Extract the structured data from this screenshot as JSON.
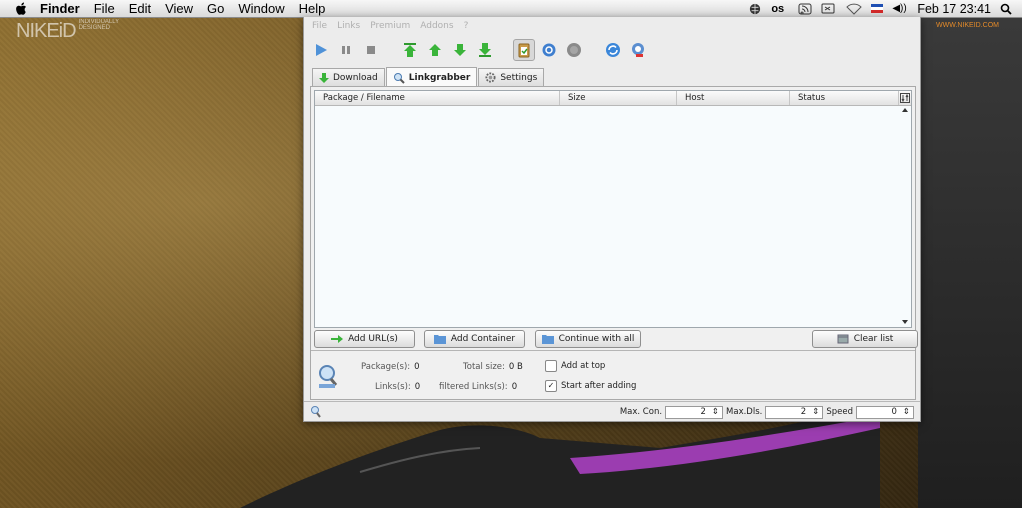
{
  "menubar": {
    "items": [
      "Finder",
      "File",
      "Edit",
      "View",
      "Go",
      "Window",
      "Help"
    ],
    "clock": "Feb 17 23:41"
  },
  "desktop": {
    "brand": "NIKEiD",
    "brand_tag": "INDIVIDUALLY DESIGNED",
    "brand_url": "WWW.NIKEID.COM"
  },
  "app": {
    "menu": [
      "File",
      "Links",
      "Premium",
      "Addons",
      "?"
    ],
    "toolbar_icons": [
      "play-icon",
      "pause-icon",
      "stop-icon",
      "move-top-icon",
      "move-up-icon",
      "move-down-icon",
      "move-bottom-icon",
      "clipboard-observer-icon",
      "auto-reconnect-icon",
      "premium-icon",
      "refresh-icon",
      "update-icon"
    ],
    "tabs": [
      {
        "label": "Download",
        "icon": "download-icon"
      },
      {
        "label": "Linkgrabber",
        "icon": "linkgrabber-icon"
      },
      {
        "label": "Settings",
        "icon": "settings-icon"
      }
    ],
    "table": {
      "columns": [
        "Package / Filename",
        "Size",
        "Host",
        "Status"
      ],
      "rows": []
    },
    "buttons": {
      "add_url": "Add URL(s)",
      "add_container": "Add Container",
      "continue_all": "Continue with all",
      "clear_list": "Clear list"
    },
    "stats": {
      "packages_label": "Package(s):",
      "packages_value": "0",
      "total_size_label": "Total size:",
      "total_size_value": "0 B",
      "links_label": "Links(s):",
      "links_value": "0",
      "filtered_label": "filtered Links(s):",
      "filtered_value": "0"
    },
    "options": {
      "add_at_top": {
        "label": "Add at top",
        "checked": false
      },
      "start_after_adding": {
        "label": "Start after adding",
        "checked": true
      }
    },
    "bottom": {
      "max_con_label": "Max. Con.",
      "max_con_value": "2",
      "max_dls_label": "Max.Dls.",
      "max_dls_value": "2",
      "speed_label": "Speed",
      "speed_value": "0"
    },
    "colors": {
      "accent_green": "#3aa63a",
      "accent_blue": "#2a7fd4"
    }
  }
}
